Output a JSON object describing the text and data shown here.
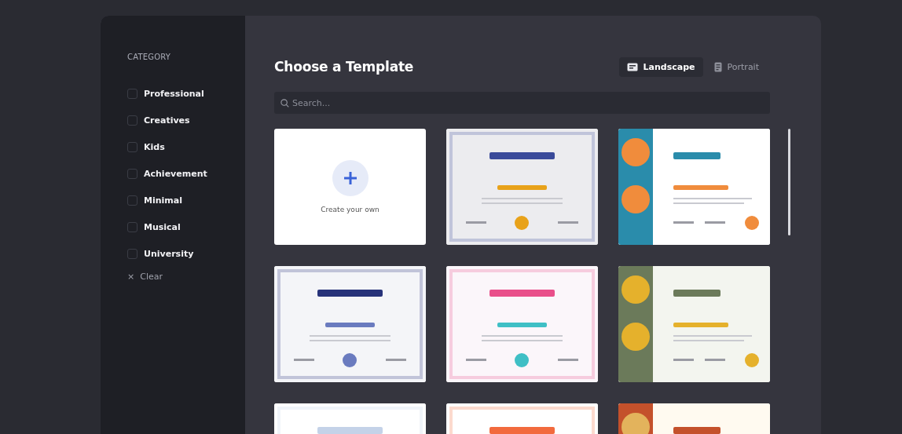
{
  "sidebar": {
    "heading": "CATEGORY",
    "categories": [
      {
        "label": "Professional",
        "checked": false
      },
      {
        "label": "Creatives",
        "checked": false
      },
      {
        "label": "Kids",
        "checked": false
      },
      {
        "label": "Achievement",
        "checked": false
      },
      {
        "label": "Minimal",
        "checked": false
      },
      {
        "label": "Musical",
        "checked": false
      },
      {
        "label": "University",
        "checked": false
      }
    ],
    "clear": {
      "icon": "×",
      "label": "Clear"
    }
  },
  "header": {
    "title": "Choose a Template",
    "orientations": [
      {
        "label": "Landscape",
        "selected": true,
        "kind": "landscape"
      },
      {
        "label": "Portrait",
        "selected": false,
        "kind": "portrait"
      }
    ]
  },
  "search": {
    "placeholder": "Search..."
  },
  "templates": [
    {
      "kind": "create",
      "label": "Create your own"
    },
    {
      "kind": "certificate"
    },
    {
      "kind": "certificate"
    },
    {
      "kind": "certificate"
    },
    {
      "kind": "certificate"
    },
    {
      "kind": "certificate"
    },
    {
      "kind": "certificate"
    },
    {
      "kind": "certificate"
    },
    {
      "kind": "certificate"
    }
  ]
}
